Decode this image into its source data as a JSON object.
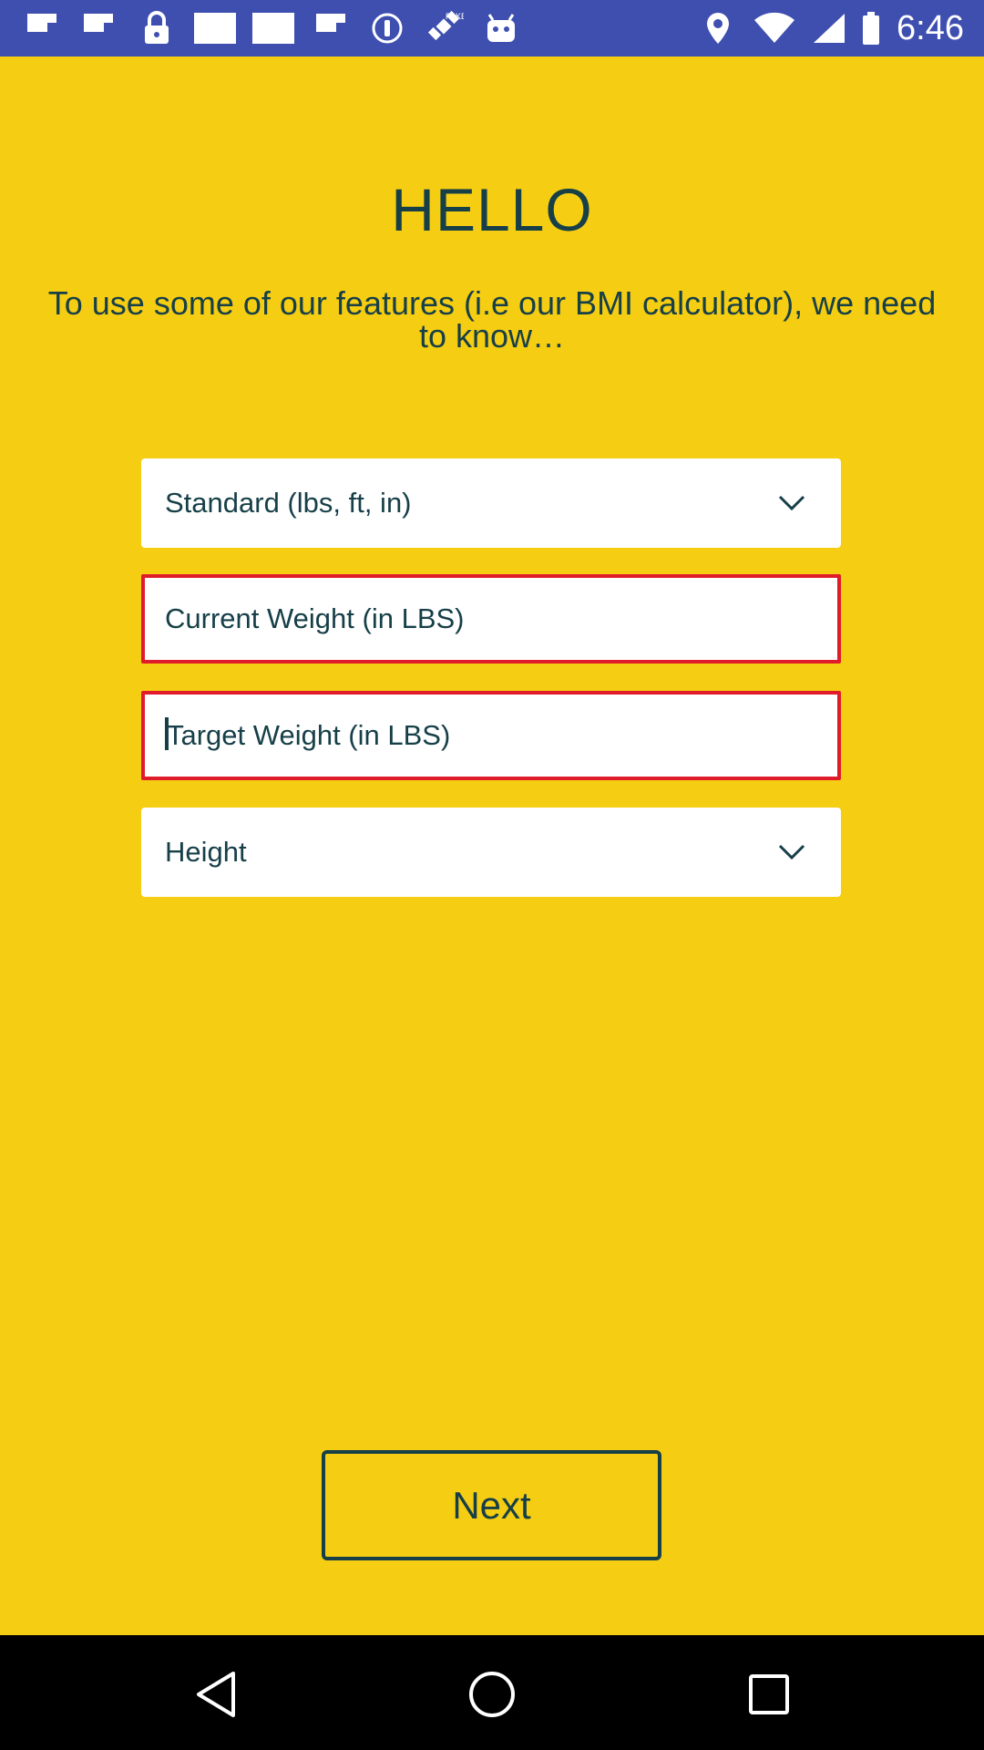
{
  "status_bar": {
    "time": "6:46",
    "left_icons": [
      "flipboard-icon",
      "flipboard-icon",
      "lock-icon",
      "white-square-icon",
      "white-square-icon",
      "flipboard-icon",
      "info-circle-icon",
      "satellite-fake-gps-icon",
      "android-robot-icon"
    ],
    "right_icons": [
      "location-pin-icon",
      "wifi-icon",
      "signal-icon",
      "battery-icon"
    ]
  },
  "page": {
    "title": "HELLO",
    "intro": "To use some of our features (i.e our BMI calculator), we need to know…",
    "background_color": "#F5CD12",
    "text_color": "#163F48",
    "error_color": "#E01B2A"
  },
  "form": {
    "units": {
      "selected": "Standard (lbs, ft, in)"
    },
    "current_weight": {
      "placeholder": "Current Weight (in LBS)",
      "value": ""
    },
    "target_weight": {
      "placeholder": "Target Weight (in LBS)",
      "value": ""
    },
    "height": {
      "selected": "Height"
    }
  },
  "actions": {
    "next_label": "Next"
  },
  "nav_bar": {
    "buttons": [
      "back-icon",
      "home-icon",
      "recents-icon"
    ]
  }
}
